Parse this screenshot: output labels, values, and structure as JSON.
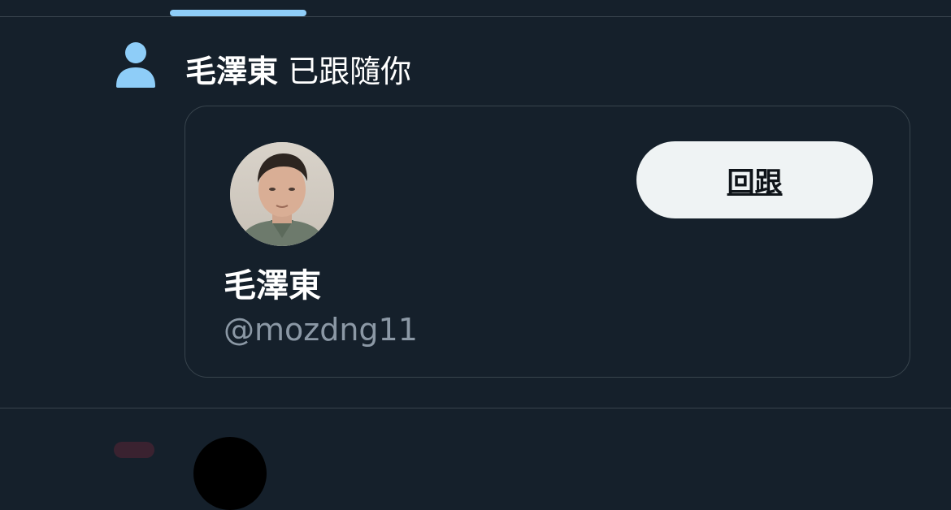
{
  "notification": {
    "name": "毛澤東",
    "action": "已跟隨你"
  },
  "card": {
    "display_name": "毛澤東",
    "handle": "@mozdng11",
    "follow_back_label": "回跟"
  },
  "icons": {
    "notification": "person-icon",
    "avatar": "profile-photo"
  },
  "colors": {
    "background": "#15202b",
    "accent": "#8ecdf8",
    "divider": "#38444d",
    "button_bg": "#eff3f4",
    "secondary_text": "#8b98a5"
  }
}
